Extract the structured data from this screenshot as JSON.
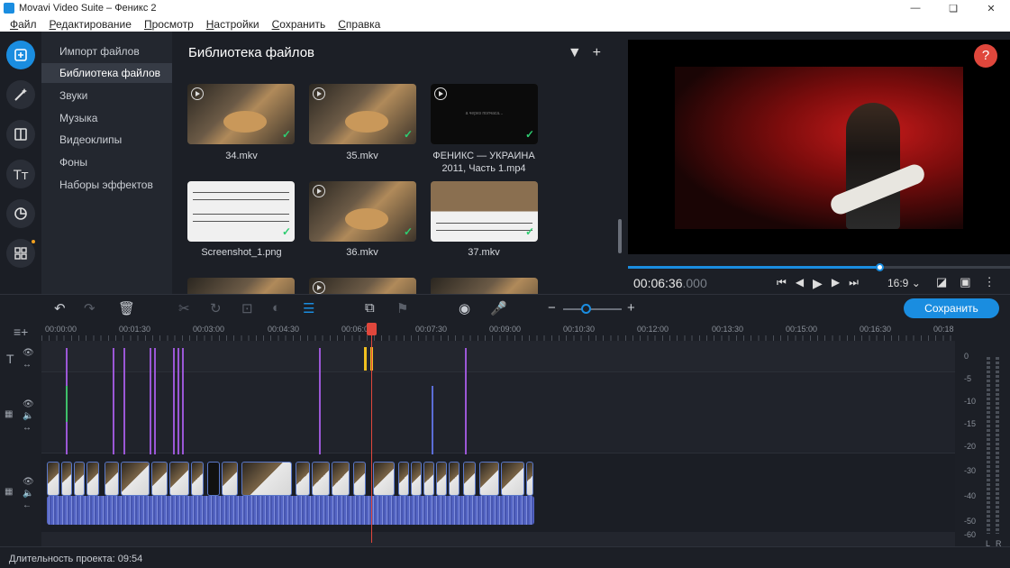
{
  "window": {
    "title": "Movavi Video Suite – Феникс 2"
  },
  "menu": [
    "Файл",
    "Редактирование",
    "Просмотр",
    "Настройки",
    "Сохранить",
    "Справка"
  ],
  "categories": [
    {
      "label": "Импорт файлов"
    },
    {
      "label": "Библиотека файлов",
      "active": true
    },
    {
      "label": "Звуки"
    },
    {
      "label": "Музыка"
    },
    {
      "label": "Видеоклипы"
    },
    {
      "label": "Фоны"
    },
    {
      "label": "Наборы эффектов"
    }
  ],
  "library": {
    "title": "Библиотека файлов",
    "items": [
      {
        "name": "34.mkv",
        "kind": "video"
      },
      {
        "name": "35.mkv",
        "kind": "video"
      },
      {
        "name": "ФЕНИКС — УКРАИНА 2011, Часть 1.mp4",
        "kind": "dark",
        "caption": "а через полчаса..."
      },
      {
        "name": "Screenshot_1.png",
        "kind": "sheet"
      },
      {
        "name": "36.mkv",
        "kind": "video"
      },
      {
        "name": "37.mkv",
        "kind": "half"
      }
    ]
  },
  "player": {
    "timecode_main": "00:06:36",
    "timecode_ms": ".000",
    "progress": 0.66,
    "aspect": "16:9"
  },
  "toolbar": {
    "save_label": "Сохранить",
    "zoom": 0.38
  },
  "ruler": [
    "00:00:00",
    "00:01:30",
    "00:03:00",
    "00:04:30",
    "00:06:00",
    "00:07:30",
    "00:09:00",
    "00:10:30",
    "00:12:00",
    "00:13:30",
    "00:15:00",
    "00:16:30",
    "00:18"
  ],
  "meter": {
    "labels": [
      "0",
      "-5",
      "-10",
      "-15",
      "-20",
      "-30",
      "-40",
      "-50",
      "-60"
    ],
    "left": "L",
    "right": "R"
  },
  "status": {
    "text": "Длительность проекта: 09:54"
  },
  "colors": {
    "accent": "#1a8de0",
    "playhead": "#e0473c",
    "marker": "#9b57d6"
  }
}
